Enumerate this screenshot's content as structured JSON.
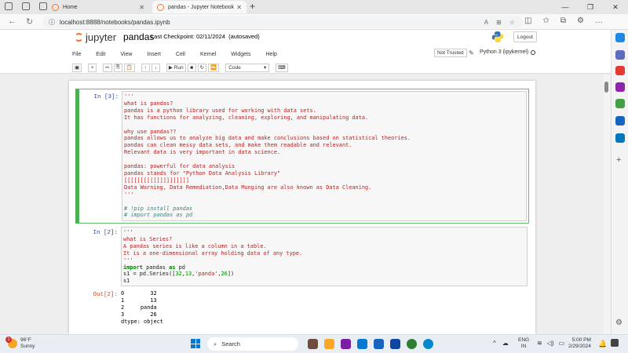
{
  "browser": {
    "tabs": [
      {
        "title": "Home",
        "active": false
      },
      {
        "title": "pandas - Jupyter Notebook",
        "active": true
      }
    ],
    "url": "localhost:8888/notebooks/pandas.ipynb"
  },
  "jupyter": {
    "logo_text": "jupyter",
    "notebook_name": "pandas",
    "checkpoint": "Last Checkpoint: 02/11/2024",
    "autosaved": "(autosaved)",
    "logout_label": "Logout",
    "menu": [
      "File",
      "Edit",
      "View",
      "Insert",
      "Cell",
      "Kernel",
      "Widgets",
      "Help"
    ],
    "trust_status": "Not Trusted",
    "kernel": "Python 3 (ipykernel)",
    "toolbar": {
      "run_label": "Run",
      "cell_type": "Code"
    }
  },
  "cells": [
    {
      "prompt": "In [3]:",
      "lines": [
        "'''",
        "what is pandas?",
        "pandas is a python library used for working with data sets.",
        "It has functions for analyzing, cleaning, exploring, and manipulating data.",
        "",
        "why use pandas??",
        "pandas allows us to analyze big data and make conclusions based on statistical theories.",
        "pandas can clean messy data sets, and make them readable and relevant.",
        "Relevant data is very important in data science.",
        "",
        "pandas: powerful for data analysis",
        "pandas stands for \"Python Data Analysis Library\"",
        "[[[[[[[[[[]]]]]]]]]]",
        "Data Warning, Data Remediation,Data Munging are also known as Data Cleaning.",
        "'''",
        "",
        "# !pip install pandas",
        "# import pandas as pd"
      ]
    },
    {
      "prompt": "In [2]:",
      "lines": [
        "'''",
        "what is Series?",
        "A pandas series is like a column in a table.",
        "It is a one-dimensional array holding data of any type.",
        "'''"
      ],
      "code": {
        "import_kw": "import",
        "module": "pandas",
        "as_kw": "as",
        "alias": "pd",
        "assign_prefix": "s1 = pd.Series([",
        "n1": "32",
        "comma1": ",",
        "n2": "13",
        "comma2": ",",
        "s": "'panda'",
        "comma3": ",",
        "n3": "26",
        "assign_suffix": "])",
        "last": "s1"
      },
      "out_prompt": "Out[2]:",
      "output": [
        "0        32",
        "1        13",
        "2     panda",
        "3        26",
        "dtype: object"
      ]
    }
  ],
  "taskbar": {
    "weather_temp": "96°F",
    "weather_desc": "Sunny",
    "weather_badge": "1",
    "search_label": "Search",
    "lang_top": "ENG",
    "lang_bottom": "IN",
    "time": "5:00 PM",
    "date": "2/29/2024"
  }
}
